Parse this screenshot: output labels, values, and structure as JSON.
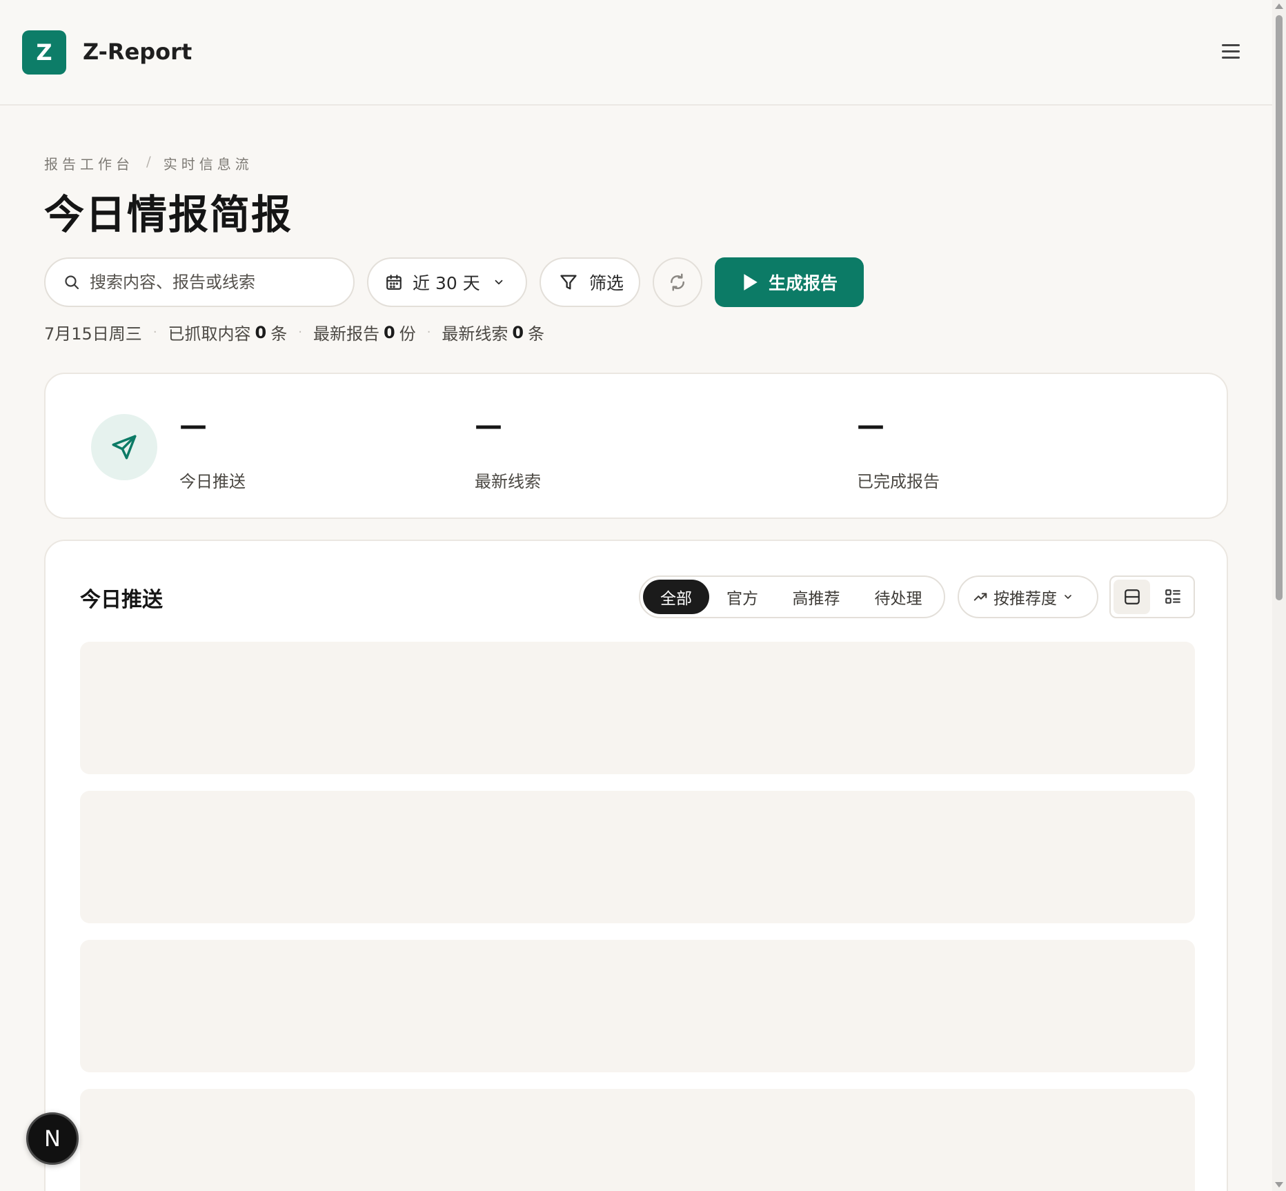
{
  "app": {
    "logo_letter": "Z",
    "title": "Z-Report"
  },
  "breadcrumb": {
    "items": [
      "报告工作台",
      "实时信息流"
    ],
    "separator": "/"
  },
  "page": {
    "title": "今日情报简报"
  },
  "toolbar": {
    "search_placeholder": "搜索内容、报告或线索",
    "date_range_label": "近 30 天",
    "filter_label": "筛选",
    "generate_label": "生成报告"
  },
  "meta": {
    "date": "7月15日周三",
    "fetched_prefix": "已抓取内容",
    "fetched_count": "0",
    "fetched_unit": "条",
    "reports_prefix": "最新报告",
    "reports_count": "0",
    "reports_unit": "份",
    "leads_prefix": "最新线索",
    "leads_count": "0",
    "leads_unit": "条"
  },
  "stats": [
    {
      "value": "—",
      "label": "今日推送"
    },
    {
      "value": "—",
      "label": "最新线索"
    },
    {
      "value": "—",
      "label": "已完成报告"
    }
  ],
  "feed": {
    "title": "今日推送",
    "tabs": [
      "全部",
      "官方",
      "高推荐",
      "待处理"
    ],
    "active_tab": "全部",
    "sort_label": "按推荐度"
  },
  "fab": {
    "label": "N"
  },
  "colors": {
    "brand": "#0c7b66",
    "accent_light": "#e6f2ee",
    "active_tab_bg": "#1b1b1b"
  },
  "icons": [
    "search-icon",
    "calendar-icon",
    "chevron-down-icon",
    "filter-icon",
    "refresh-icon",
    "play-icon",
    "send-icon",
    "trend-icon",
    "menu-icon",
    "card-view-icon",
    "list-view-icon"
  ]
}
